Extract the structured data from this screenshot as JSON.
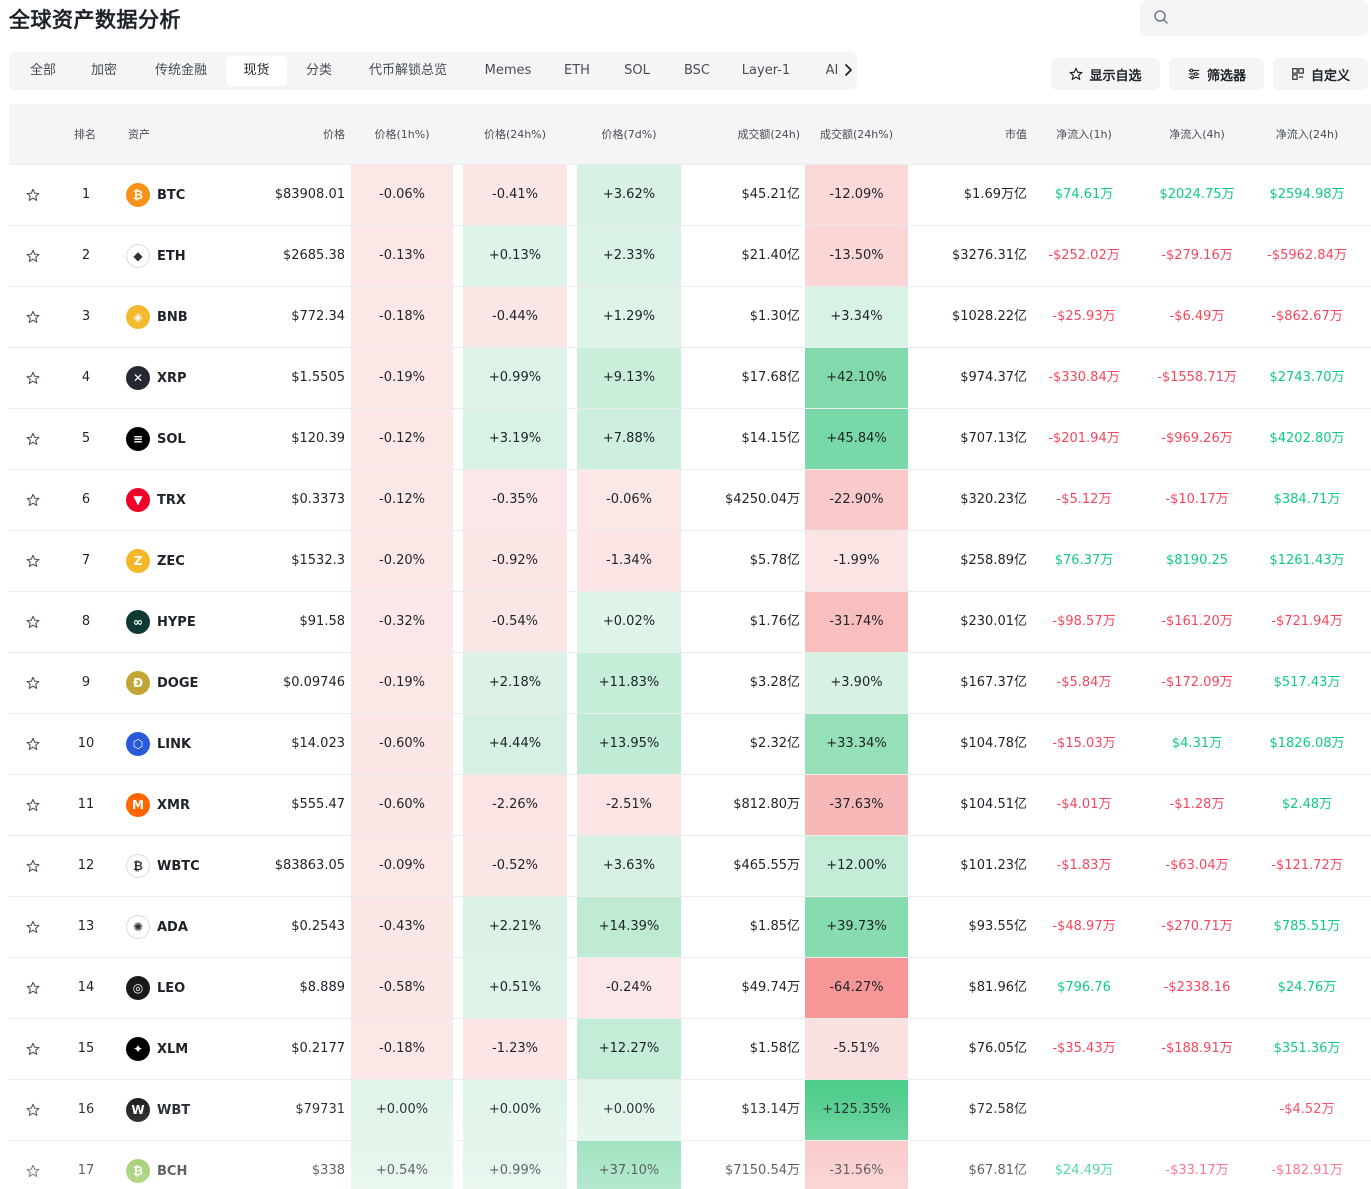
{
  "page": {
    "title": "全球资产数据分析"
  },
  "search": {
    "placeholder": ""
  },
  "tabs": [
    {
      "label": "全部",
      "active": false
    },
    {
      "label": "加密",
      "active": false
    },
    {
      "label": "传统金融",
      "active": false
    },
    {
      "label": "现货",
      "active": true
    },
    {
      "label": "分类",
      "active": false
    },
    {
      "label": "代币解锁总览",
      "active": false
    },
    {
      "label": "Memes",
      "active": false
    },
    {
      "label": "ETH",
      "active": false
    },
    {
      "label": "SOL",
      "active": false
    },
    {
      "label": "BSC",
      "active": false
    },
    {
      "label": "Layer-1",
      "active": false
    },
    {
      "label": "AI",
      "active": false
    }
  ],
  "toolbar": {
    "watchlist_label": "显示自选",
    "filter_label": "筛选器",
    "customize_label": "自定义"
  },
  "columns": {
    "rank": "排名",
    "asset": "资产",
    "price": "价格",
    "price_1h": "价格(1h%)",
    "price_24h": "价格(24h%)",
    "price_7d": "价格(7d%)",
    "volume": "成交额(24h)",
    "volume_chg": "成交额(24h%)",
    "mcap": "市值",
    "flow_1h": "净流入(1h)",
    "flow_4h": "净流入(4h)",
    "flow_24h": "净流入(24h)"
  },
  "colors": {
    "positive": "#0ecb81",
    "negative": "#f6465d",
    "header_bg": "#f5f5f5"
  },
  "rows": [
    {
      "rank": "1",
      "symbol": "BTC",
      "icon": "bitcoin-icon",
      "icon_color": "#f7931a",
      "icon_glyph": "₿",
      "price": "$83908.01",
      "p1h": "-0.06%",
      "p24h": "-0.41%",
      "p7d": "+3.62%",
      "volume": "$45.21亿",
      "vchg": "-12.09%",
      "mcap": "$1.69万亿",
      "f1h": "$74.61万",
      "f4h": "$2024.75万",
      "f24h": "$2594.98万"
    },
    {
      "rank": "2",
      "symbol": "ETH",
      "icon": "ethereum-icon",
      "icon_color": "#ffffff",
      "icon_glyph": "◆",
      "price": "$2685.38",
      "p1h": "-0.13%",
      "p24h": "+0.13%",
      "p7d": "+2.33%",
      "volume": "$21.40亿",
      "vchg": "-13.50%",
      "mcap": "$3276.31亿",
      "f1h": "-$252.02万",
      "f4h": "-$279.16万",
      "f24h": "-$5962.84万"
    },
    {
      "rank": "3",
      "symbol": "BNB",
      "icon": "bnb-icon",
      "icon_color": "#f3ba2f",
      "icon_glyph": "◈",
      "price": "$772.34",
      "p1h": "-0.18%",
      "p24h": "-0.44%",
      "p7d": "+1.29%",
      "volume": "$1.30亿",
      "vchg": "+3.34%",
      "mcap": "$1028.22亿",
      "f1h": "-$25.93万",
      "f4h": "-$6.49万",
      "f24h": "-$862.67万"
    },
    {
      "rank": "4",
      "symbol": "XRP",
      "icon": "xrp-icon",
      "icon_color": "#23292f",
      "icon_glyph": "✕",
      "price": "$1.5505",
      "p1h": "-0.19%",
      "p24h": "+0.99%",
      "p7d": "+9.13%",
      "volume": "$17.68亿",
      "vchg": "+42.10%",
      "mcap": "$974.37亿",
      "f1h": "-$330.84万",
      "f4h": "-$1558.71万",
      "f24h": "$2743.70万"
    },
    {
      "rank": "5",
      "symbol": "SOL",
      "icon": "solana-icon",
      "icon_color": "#000000",
      "icon_glyph": "≡",
      "price": "$120.39",
      "p1h": "-0.12%",
      "p24h": "+3.19%",
      "p7d": "+7.88%",
      "volume": "$14.15亿",
      "vchg": "+45.84%",
      "mcap": "$707.13亿",
      "f1h": "-$201.94万",
      "f4h": "-$969.26万",
      "f24h": "$4202.80万"
    },
    {
      "rank": "6",
      "symbol": "TRX",
      "icon": "tron-icon",
      "icon_color": "#ef0027",
      "icon_glyph": "▼",
      "price": "$0.3373",
      "p1h": "-0.12%",
      "p24h": "-0.35%",
      "p7d": "-0.06%",
      "volume": "$4250.04万",
      "vchg": "-22.90%",
      "mcap": "$320.23亿",
      "f1h": "-$5.12万",
      "f4h": "-$10.17万",
      "f24h": "$384.71万"
    },
    {
      "rank": "7",
      "symbol": "ZEC",
      "icon": "zcash-icon",
      "icon_color": "#f4b728",
      "icon_glyph": "Z",
      "price": "$1532.3",
      "p1h": "-0.20%",
      "p24h": "-0.92%",
      "p7d": "-1.34%",
      "volume": "$5.78亿",
      "vchg": "-1.99%",
      "mcap": "$258.89亿",
      "f1h": "$76.37万",
      "f4h": "$8190.25",
      "f24h": "$1261.43万"
    },
    {
      "rank": "8",
      "symbol": "HYPE",
      "icon": "hyperliquid-icon",
      "icon_color": "#0f3933",
      "icon_glyph": "∞",
      "price": "$91.58",
      "p1h": "-0.32%",
      "p24h": "-0.54%",
      "p7d": "+0.02%",
      "volume": "$1.76亿",
      "vchg": "-31.74%",
      "mcap": "$230.01亿",
      "f1h": "-$98.57万",
      "f4h": "-$161.20万",
      "f24h": "-$721.94万"
    },
    {
      "rank": "9",
      "symbol": "DOGE",
      "icon": "dogecoin-icon",
      "icon_color": "#c2a633",
      "icon_glyph": "Ð",
      "price": "$0.09746",
      "p1h": "-0.19%",
      "p24h": "+2.18%",
      "p7d": "+11.83%",
      "volume": "$3.28亿",
      "vchg": "+3.90%",
      "mcap": "$167.37亿",
      "f1h": "-$5.84万",
      "f4h": "-$172.09万",
      "f24h": "$517.43万"
    },
    {
      "rank": "10",
      "symbol": "LINK",
      "icon": "chainlink-icon",
      "icon_color": "#2a5ada",
      "icon_glyph": "⬡",
      "price": "$14.023",
      "p1h": "-0.60%",
      "p24h": "+4.44%",
      "p7d": "+13.95%",
      "volume": "$2.32亿",
      "vchg": "+33.34%",
      "mcap": "$104.78亿",
      "f1h": "-$15.03万",
      "f4h": "$4.31万",
      "f24h": "$1826.08万"
    },
    {
      "rank": "11",
      "symbol": "XMR",
      "icon": "monero-icon",
      "icon_color": "#ff6600",
      "icon_glyph": "M",
      "price": "$555.47",
      "p1h": "-0.60%",
      "p24h": "-2.26%",
      "p7d": "-2.51%",
      "volume": "$812.80万",
      "vchg": "-37.63%",
      "mcap": "$104.51亿",
      "f1h": "-$4.01万",
      "f4h": "-$1.28万",
      "f24h": "$2.48万"
    },
    {
      "rank": "12",
      "symbol": "WBTC",
      "icon": "wrapped-bitcoin-icon",
      "icon_color": "#ffffff",
      "icon_glyph": "₿",
      "price": "$83863.05",
      "p1h": "-0.09%",
      "p24h": "-0.52%",
      "p7d": "+3.63%",
      "volume": "$465.55万",
      "vchg": "+12.00%",
      "mcap": "$101.23亿",
      "f1h": "-$1.83万",
      "f4h": "-$63.04万",
      "f24h": "-$121.72万"
    },
    {
      "rank": "13",
      "symbol": "ADA",
      "icon": "cardano-icon",
      "icon_color": "#ffffff",
      "icon_glyph": "✺",
      "price": "$0.2543",
      "p1h": "-0.43%",
      "p24h": "+2.21%",
      "p7d": "+14.39%",
      "volume": "$1.85亿",
      "vchg": "+39.73%",
      "mcap": "$93.55亿",
      "f1h": "-$48.97万",
      "f4h": "-$270.71万",
      "f24h": "$785.51万"
    },
    {
      "rank": "14",
      "symbol": "LEO",
      "icon": "unus-sed-leo-icon",
      "icon_color": "#1a1a1a",
      "icon_glyph": "◎",
      "price": "$8.889",
      "p1h": "-0.58%",
      "p24h": "+0.51%",
      "p7d": "-0.24%",
      "volume": "$49.74万",
      "vchg": "-64.27%",
      "mcap": "$81.96亿",
      "f1h": "$796.76",
      "f4h": "-$2338.16",
      "f24h": "$24.76万"
    },
    {
      "rank": "15",
      "symbol": "XLM",
      "icon": "stellar-icon",
      "icon_color": "#000000",
      "icon_glyph": "✦",
      "price": "$0.2177",
      "p1h": "-0.18%",
      "p24h": "-1.23%",
      "p7d": "+12.27%",
      "volume": "$1.58亿",
      "vchg": "-5.51%",
      "mcap": "$76.05亿",
      "f1h": "-$35.43万",
      "f4h": "-$188.91万",
      "f24h": "$351.36万"
    },
    {
      "rank": "16",
      "symbol": "WBT",
      "icon": "whitebit-icon",
      "icon_color": "#1a1a1a",
      "icon_glyph": "W",
      "price": "$79731",
      "p1h": "+0.00%",
      "p24h": "+0.00%",
      "p7d": "+0.00%",
      "volume": "$13.14万",
      "vchg": "+125.35%",
      "mcap": "$72.58亿",
      "f1h": "",
      "f4h": "",
      "f24h": "-$4.52万"
    },
    {
      "rank": "17",
      "symbol": "BCH",
      "icon": "bitcoin-cash-icon",
      "icon_color": "#8dc351",
      "icon_glyph": "₿",
      "price": "$338",
      "p1h": "+0.54%",
      "p24h": "+0.99%",
      "p7d": "+37.10%",
      "volume": "$7150.54万",
      "vchg": "-31.56%",
      "mcap": "$67.81亿",
      "f1h": "$24.49万",
      "f4h": "-$33.17万",
      "f24h": "-$182.91万"
    }
  ]
}
